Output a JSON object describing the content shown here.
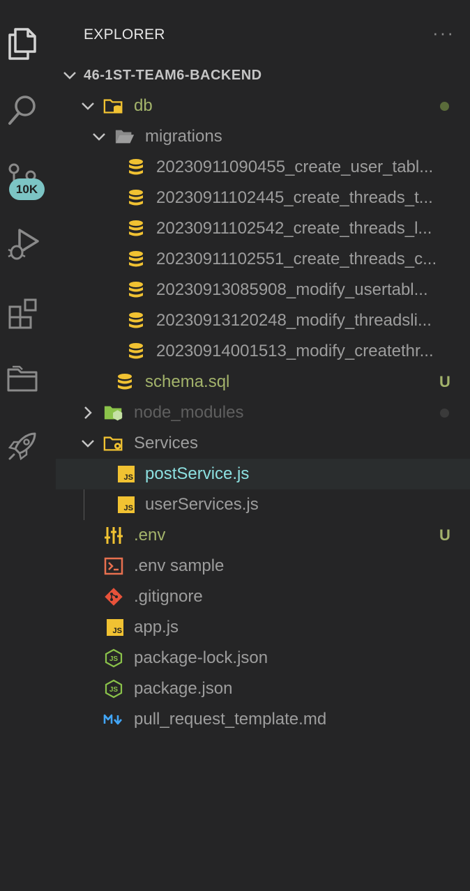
{
  "activity_bar": {
    "items": [
      {
        "icon": "files-icon"
      },
      {
        "icon": "search-icon"
      },
      {
        "icon": "source-control-icon",
        "badge": "10K"
      },
      {
        "icon": "run-debug-icon"
      },
      {
        "icon": "extensions-icon"
      },
      {
        "icon": "remote-explorer-icon"
      },
      {
        "icon": "rocket-icon"
      }
    ]
  },
  "explorer": {
    "title": "EXPLORER",
    "more_actions": "···",
    "project": "46-1ST-TEAM6-BACKEND",
    "tree": [
      {
        "label": "db",
        "type": "folder-db",
        "expanded": true
      },
      {
        "label": "migrations",
        "type": "folder",
        "expanded": true
      },
      {
        "label": "20230911090455_create_user_tabl...",
        "type": "sql"
      },
      {
        "label": "20230911102445_create_threads_t...",
        "type": "sql"
      },
      {
        "label": "20230911102542_create_threads_l...",
        "type": "sql"
      },
      {
        "label": "20230911102551_create_threads_c...",
        "type": "sql"
      },
      {
        "label": "20230913085908_modify_usertabl...",
        "type": "sql"
      },
      {
        "label": "20230913120248_modify_threadsli...",
        "type": "sql"
      },
      {
        "label": "20230914001513_modify_createthr...",
        "type": "sql"
      },
      {
        "label": "schema.sql",
        "type": "sql",
        "status": "U"
      },
      {
        "label": "node_modules",
        "type": "folder-node",
        "expanded": false
      },
      {
        "label": "Services",
        "type": "folder-services",
        "expanded": true
      },
      {
        "label": "postService.js",
        "type": "js",
        "selected": true
      },
      {
        "label": "userServices.js",
        "type": "js"
      },
      {
        "label": ".env",
        "type": "env",
        "status": "U"
      },
      {
        "label": ".env sample",
        "type": "terminal"
      },
      {
        "label": ".gitignore",
        "type": "git"
      },
      {
        "label": "app.js",
        "type": "js"
      },
      {
        "label": "package-lock.json",
        "type": "node-json"
      },
      {
        "label": "package.json",
        "type": "node-json"
      },
      {
        "label": "pull_request_template.md",
        "type": "markdown"
      }
    ]
  },
  "colors": {
    "background": "#252526",
    "modified_green": "#a3b36b",
    "dim_text": "#9d9d9d",
    "selected_text": "#8ce0e0",
    "git_status": "#a3b36b",
    "sql_yellow": "#f1c232",
    "badge": "#7cc4c4"
  }
}
